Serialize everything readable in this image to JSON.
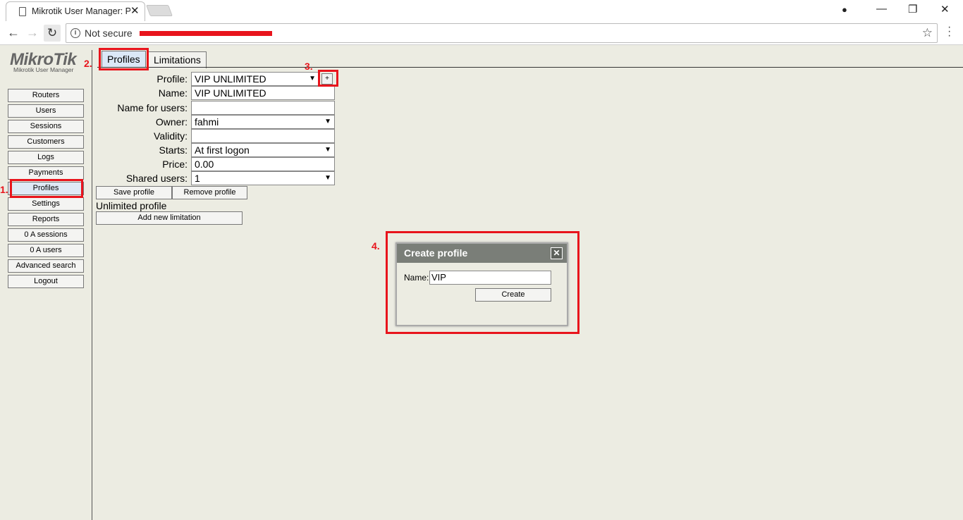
{
  "browser": {
    "tab_title": "Mikrotik User Manager: P",
    "security_label": "Not secure",
    "window_controls": {
      "minimize": "—",
      "restore": "❐",
      "close": "✕",
      "account": "●"
    }
  },
  "logo": {
    "brand": "MikroTik",
    "subtitle": "Mikrotik User Manager"
  },
  "sidebar": {
    "items": [
      {
        "label": "Routers"
      },
      {
        "label": "Users"
      },
      {
        "label": "Sessions"
      },
      {
        "label": "Customers"
      },
      {
        "label": "Logs"
      },
      {
        "label": "Payments"
      },
      {
        "label": "Profiles"
      },
      {
        "label": "Settings"
      },
      {
        "label": "Reports"
      },
      {
        "label": "0 A sessions"
      },
      {
        "label": "0 A users"
      },
      {
        "label": "Advanced search"
      },
      {
        "label": "Logout"
      }
    ]
  },
  "tabs": [
    {
      "label": "Profiles"
    },
    {
      "label": "Limitations"
    }
  ],
  "form": {
    "profile": {
      "label": "Profile:",
      "value": "VIP UNLIMITED"
    },
    "add_button": "+",
    "name": {
      "label": "Name:",
      "value": "VIP UNLIMITED"
    },
    "name_for_users": {
      "label": "Name for users:",
      "value": ""
    },
    "owner": {
      "label": "Owner:",
      "value": "fahmi"
    },
    "validity": {
      "label": "Validity:",
      "value": ""
    },
    "starts": {
      "label": "Starts:",
      "value": "At first logon"
    },
    "price": {
      "label": "Price:",
      "value": "0.00"
    },
    "shared_users": {
      "label": "Shared users:",
      "value": "1"
    },
    "save_button": "Save profile",
    "remove_button": "Remove profile",
    "limitation_title": "Unlimited profile",
    "add_limitation_button": "Add new limitation"
  },
  "dialog": {
    "title": "Create profile",
    "close_symbol": "✕",
    "name_label": "Name:",
    "name_value": "VIP",
    "create_button": "Create"
  },
  "annotations": {
    "step1": "1.",
    "step2": "2.",
    "step3": "3.",
    "step4": "4."
  },
  "colors": {
    "annotation_red": "#e8141c",
    "page_bg": "#ececE2",
    "dialog_header": "#7a7e78",
    "active_tab": "#dbe8f7"
  }
}
